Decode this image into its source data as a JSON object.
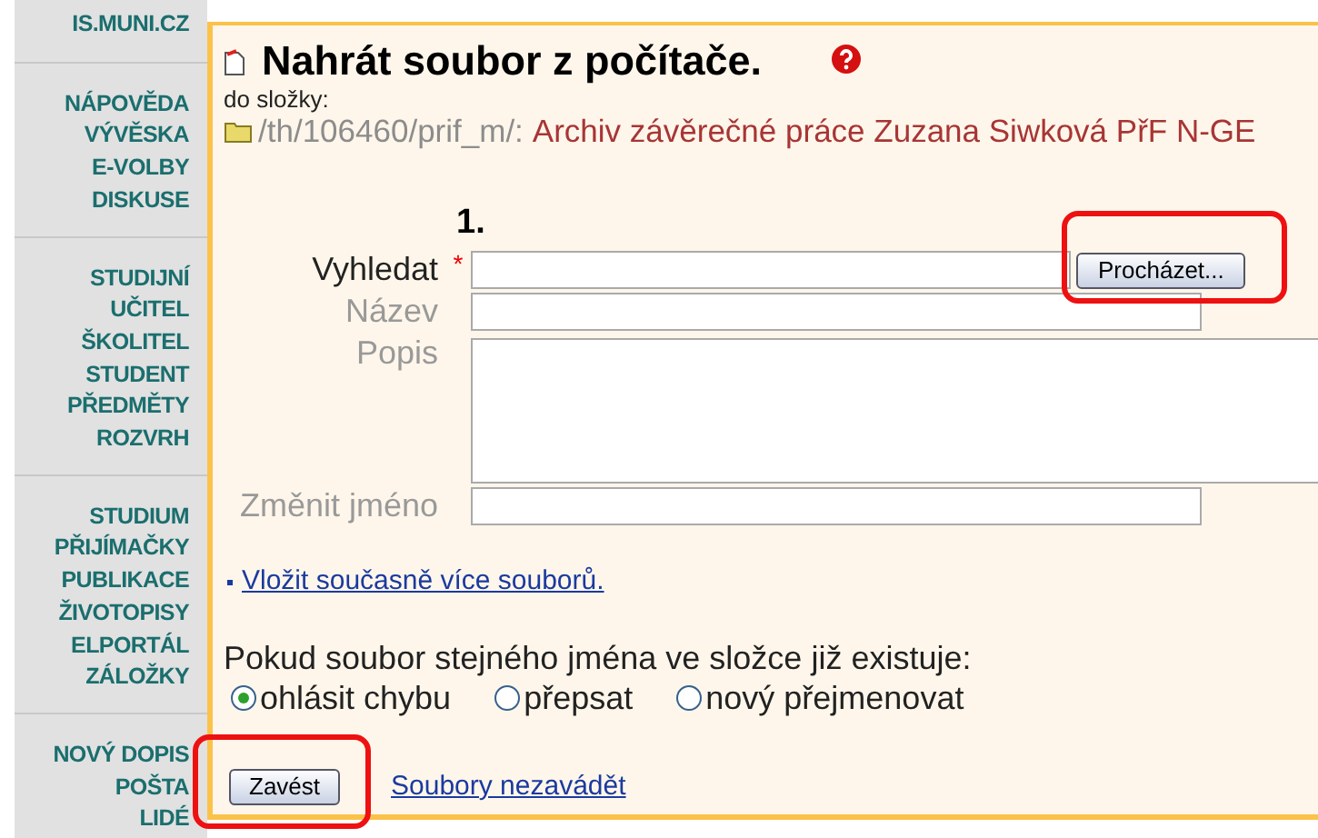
{
  "sidebar": {
    "groups": [
      [
        "IS.MUNI.CZ"
      ],
      [
        "NÁPOVĚDA",
        "VÝVĚSKA",
        "E-VOLBY",
        "DISKUSE"
      ],
      [
        "STUDIJNÍ",
        "UČITEL",
        "ŠKOLITEL",
        "STUDENT",
        "PŘEDMĚTY",
        "ROZVRH"
      ],
      [
        "STUDIUM",
        "PŘIJÍMAČKY",
        "PUBLIKACE",
        "ŽIVOTOPISY",
        "ELPORTÁL",
        "ZÁLOŽKY"
      ],
      [
        "NOVÝ DOPIS",
        "POŠTA",
        "LIDÉ"
      ]
    ]
  },
  "title": "Nahrát soubor z počítače.",
  "folder_label": "do složky:",
  "folder_path": "/th/106460/prif_m/:",
  "folder_name": "Archiv závěrečné práce Zuzana Siwková PřF N-GE",
  "form": {
    "number": "1.",
    "fields": [
      {
        "kind": "file",
        "label": "Vyhledat",
        "required_mark": "*",
        "button": "Procházet..."
      },
      {
        "kind": "text",
        "label": "Název"
      },
      {
        "kind": "textarea",
        "label": "Popis"
      },
      {
        "kind": "text",
        "label": "Změnit jméno"
      }
    ]
  },
  "multi_link": "Vložit současně více souborů.",
  "conflict_question": "Pokud soubor stejného jména ve složce již existuje:",
  "conflict_options": [
    {
      "label": "ohlásit chybu",
      "selected": true
    },
    {
      "label": "přepsat",
      "selected": false
    },
    {
      "label": "nový přejmenovat",
      "selected": false
    }
  ],
  "submit_button": "Zavést",
  "cancel_link": "Soubory nezavádět"
}
